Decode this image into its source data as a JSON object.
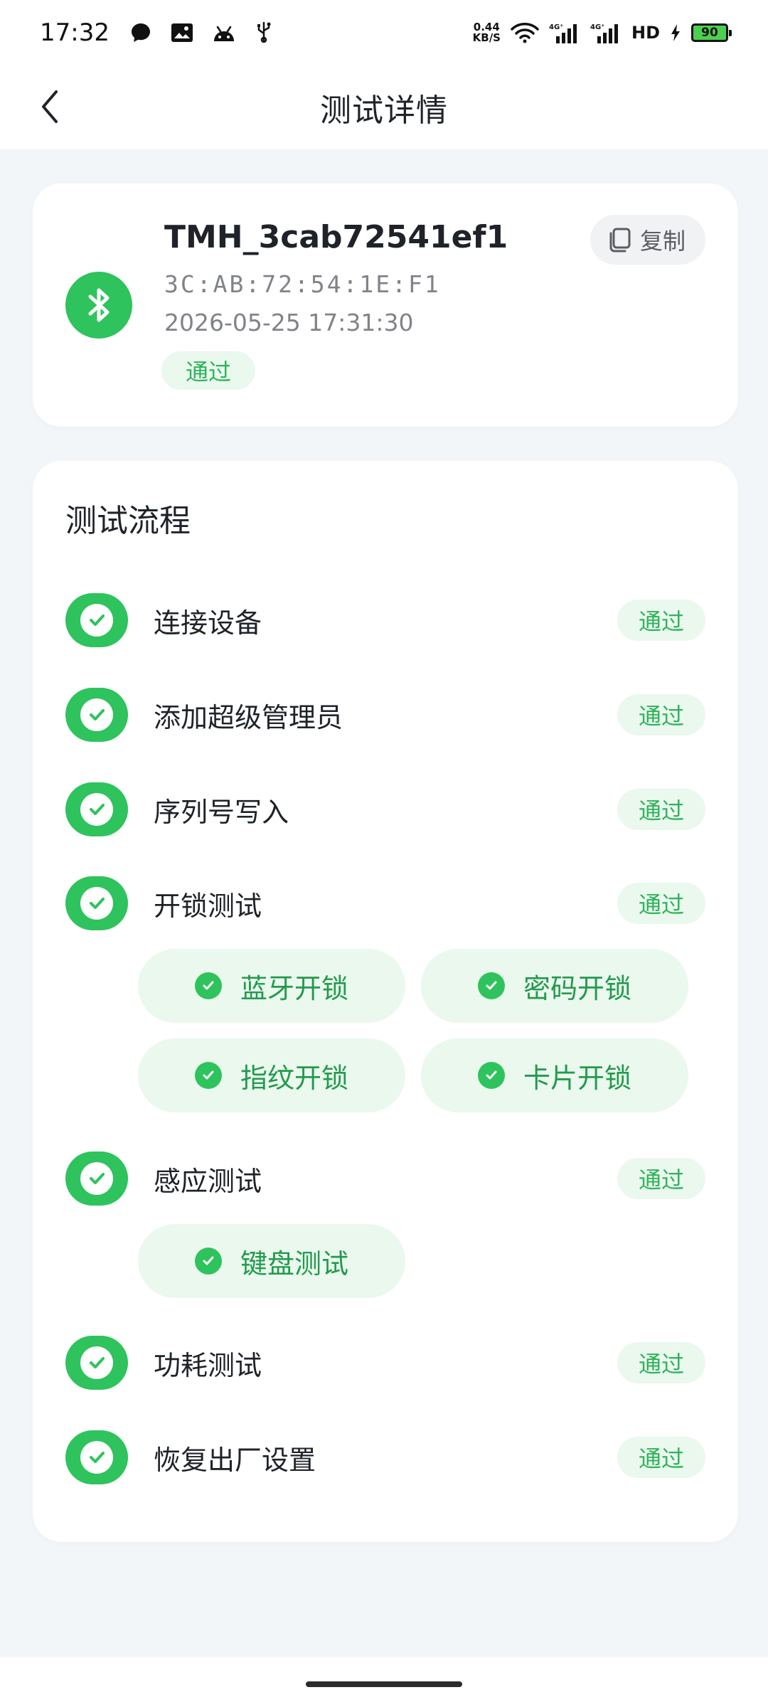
{
  "status_bar": {
    "time": "17:32",
    "net_speed_value": "0.44",
    "net_speed_unit": "KB/S",
    "signal1": "4G⁺",
    "signal2": "4G⁺",
    "hd": "HD",
    "battery": "90"
  },
  "header": {
    "title": "测试详情"
  },
  "device": {
    "name": "TMH_3cab72541ef1",
    "mac": "3C:AB:72:54:1E:F1",
    "time": "2026-05-25 17:31:30",
    "status": "通过",
    "copy_label": "复制"
  },
  "flow": {
    "title": "测试流程",
    "steps": [
      {
        "label": "连接设备",
        "status": "通过"
      },
      {
        "label": "添加超级管理员",
        "status": "通过"
      },
      {
        "label": "序列号写入",
        "status": "通过"
      },
      {
        "label": "开锁测试",
        "status": "通过"
      },
      {
        "label": "感应测试",
        "status": "通过"
      },
      {
        "label": "功耗测试",
        "status": "通过"
      },
      {
        "label": "恢复出厂设置",
        "status": "通过"
      }
    ],
    "unlock_subtests": [
      "蓝牙开锁",
      "密码开锁",
      "指纹开锁",
      "卡片开锁"
    ],
    "sensor_subtests": [
      "键盘测试"
    ]
  },
  "colors": {
    "accent_green": "#2ec35c",
    "badge_bg": "#eaf8ee",
    "badge_text": "#2eb35a",
    "page_bg": "#f3f6f9"
  },
  "icons": {
    "back": "chevron-left-icon",
    "bluetooth": "bluetooth-icon",
    "copy": "copy-icon",
    "check": "check-circle-icon"
  }
}
